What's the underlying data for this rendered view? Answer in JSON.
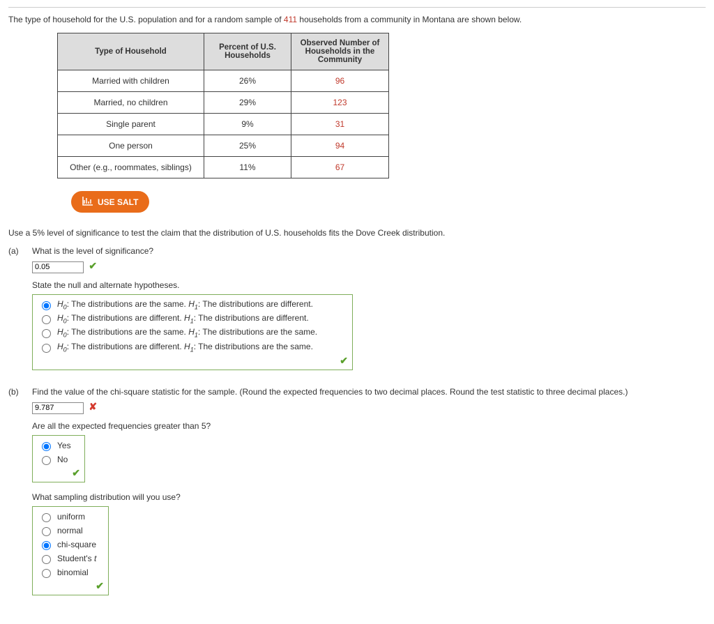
{
  "intro": {
    "prefix": "The type of household for the U.S. population and for a random sample of ",
    "sample": "411",
    "suffix": " households from a community in Montana are shown below."
  },
  "table": {
    "headers": [
      "Type of Household",
      "Percent of U.S. Households",
      "Observed Number of Households in the Community"
    ],
    "rows": [
      {
        "label": "Married with children",
        "pct": "26%",
        "obs": "96"
      },
      {
        "label": "Married, no children",
        "pct": "29%",
        "obs": "123"
      },
      {
        "label": "Single parent",
        "pct": "9%",
        "obs": "31"
      },
      {
        "label": "One person",
        "pct": "25%",
        "obs": "94"
      },
      {
        "label": "Other (e.g., roommates, siblings)",
        "pct": "11%",
        "obs": "67"
      }
    ]
  },
  "salt_label": "USE SALT",
  "instruction": "Use a 5% level of significance to test the claim that the distribution of U.S. households fits the Dove Creek distribution.",
  "part_a": {
    "label": "(a)",
    "q1": "What is the level of significance?",
    "answer1": "0.05",
    "q2": "State the null and alternate hypotheses.",
    "options": [
      {
        "h0": "The distributions are the same.",
        "h1": "The distributions are different."
      },
      {
        "h0": "The distributions are different.",
        "h1": "The distributions are different."
      },
      {
        "h0": "The distributions are the same.",
        "h1": "The distributions are the same."
      },
      {
        "h0": "The distributions are different.",
        "h1": "The distributions are the same."
      }
    ]
  },
  "part_b": {
    "label": "(b)",
    "q1": "Find the value of the chi-square statistic for the sample. (Round the expected frequencies to two decimal places. Round the test statistic to three decimal places.)",
    "answer1": "9.787",
    "q2": "Are all the expected frequencies greater than 5?",
    "yesno": [
      "Yes",
      "No"
    ],
    "q3": "What sampling distribution will you use?",
    "dists": [
      "uniform",
      "normal",
      "chi-square",
      "Student's t",
      "binomial"
    ]
  }
}
